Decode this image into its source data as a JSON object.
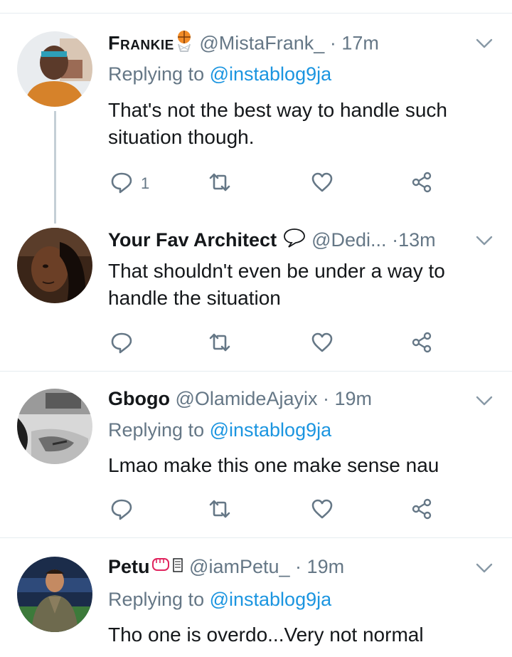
{
  "tweets": [
    {
      "name": "Frankie",
      "handle": "@MistaFrank_",
      "dot": "·",
      "time": "17m",
      "replying_prefix": "Replying to ",
      "replying_to": "@instablog9ja",
      "text_lines": [
        "That's not the best way to handle such",
        "situation though."
      ],
      "reply_count": "1",
      "retweet_count": "",
      "like_count": ""
    },
    {
      "name": "Your Fav Architect",
      "handle": "@Dedi...",
      "dot": "·",
      "time": "13m",
      "text_lines": [
        "That shouldn't even be under a way to",
        "handle the situation"
      ],
      "reply_count": "",
      "retweet_count": "",
      "like_count": ""
    },
    {
      "name": "Gbogo",
      "handle": "@OlamideAjayix",
      "dot": "·",
      "time": "19m",
      "replying_prefix": "Replying to ",
      "replying_to": "@instablog9ja",
      "text_lines": [
        "Lmao make this one make sense nau"
      ],
      "reply_count": "",
      "retweet_count": "",
      "like_count": ""
    },
    {
      "name": "Petu",
      "handle": "@iamPetu_",
      "dot": "·",
      "time": "19m",
      "replying_prefix": "Replying to ",
      "replying_to": "@instablog9ja",
      "text_lines": [
        "Tho one is overdo...Very not normal"
      ]
    }
  ],
  "icons": {
    "reply": "reply-icon",
    "retweet": "retweet-icon",
    "like": "heart-icon",
    "share": "share-icon",
    "more": "chevron-down-icon"
  },
  "colors": {
    "text": "#14171a",
    "secondary": "#657786",
    "link": "#1b95e0",
    "icon": "#657786",
    "separator": "#e6ecf0",
    "thread_line": "#c4cfd6"
  }
}
